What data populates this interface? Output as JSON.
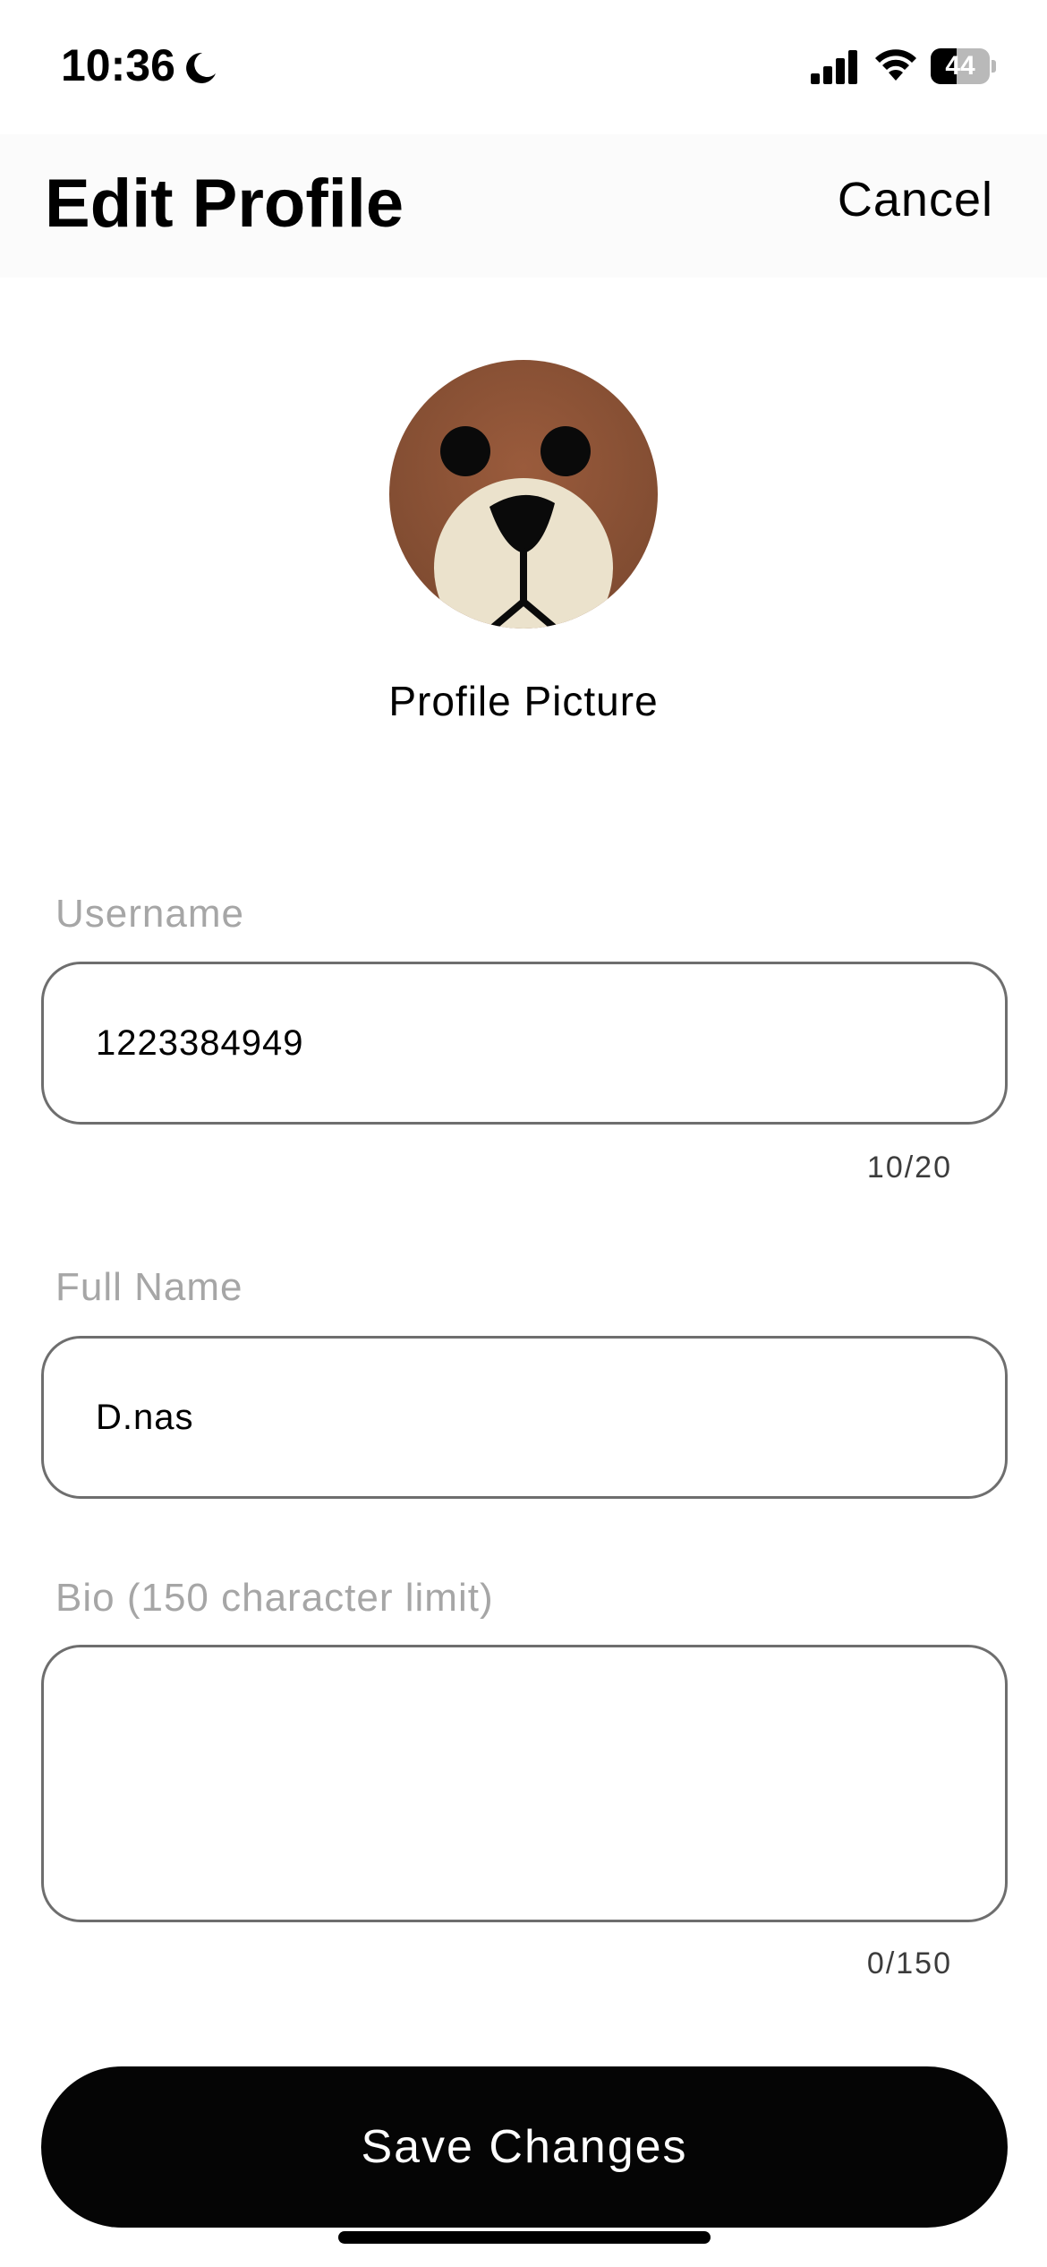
{
  "status_bar": {
    "time": "10:36",
    "battery_level": "44",
    "icons": [
      "moon-icon",
      "signal-icon",
      "wifi-icon",
      "battery-icon"
    ]
  },
  "header": {
    "title": "Edit Profile",
    "cancel_label": "Cancel"
  },
  "profile": {
    "picture_label": "Profile Picture"
  },
  "form": {
    "username": {
      "label": "Username",
      "value": "1223384949",
      "counter": "10/20"
    },
    "full_name": {
      "label": "Full Name",
      "value": "D.nas"
    },
    "bio": {
      "label": "Bio (150 character limit)",
      "value": "",
      "counter": "0/150"
    }
  },
  "actions": {
    "save_label": "Save Changes"
  },
  "colors": {
    "background": "#ffffff",
    "header_background": "#fbfbfb",
    "label_gray": "#a6a6a6",
    "field_border": "#6e6e6e",
    "button_background": "#050505",
    "button_text": "#ffffff"
  }
}
